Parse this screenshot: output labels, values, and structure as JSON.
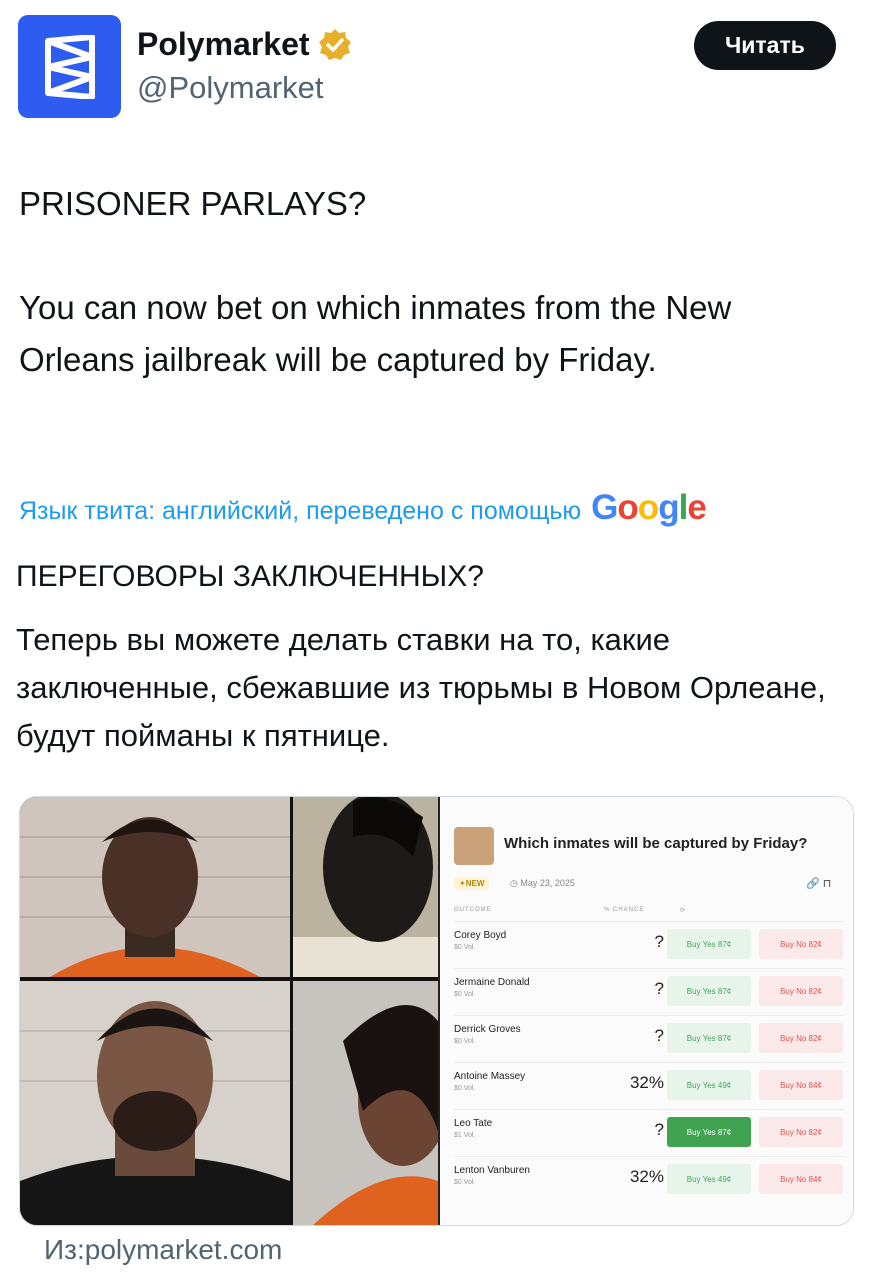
{
  "account": {
    "name": "Polymarket",
    "handle": "@Polymarket",
    "follow_label": "Читать",
    "avatar_color": "#2e5bf0",
    "verified": true
  },
  "tweet": {
    "title": "PRISONER PARLAYS?",
    "body": "You can now bet on which inmates from the New Orleans jailbreak will be captured by Friday."
  },
  "translation": {
    "notice": "Язык твита: английский, переведено с помощью",
    "provider": "Google",
    "title": "ПЕРЕГОВОРЫ ЗАКЛЮЧЕННЫХ?",
    "body": "Теперь вы можете делать ставки на то, какие заключенные, сбежавшие из тюрьмы в Новом Орлеане, будут пойманы к пятнице."
  },
  "market": {
    "title": "Which inmates will be captured by Friday?",
    "badge": "✦NEW",
    "date": "May 23, 2025",
    "col_outcome": "OUTCOME",
    "col_chance": "% CHANCE",
    "outcomes": [
      {
        "name": "Corey Boyd",
        "vol": "$0 Vol.",
        "chance": "?",
        "buy_yes": "Buy Yes 87¢",
        "buy_no": "Buy No 82¢"
      },
      {
        "name": "Jermaine Donald",
        "vol": "$0 Vol.",
        "chance": "?",
        "buy_yes": "Buy Yes 87¢",
        "buy_no": "Buy No 82¢"
      },
      {
        "name": "Derrick Groves",
        "vol": "$0 Vol.",
        "chance": "?",
        "buy_yes": "Buy Yes 87¢",
        "buy_no": "Buy No 82¢"
      },
      {
        "name": "Antoine Massey",
        "vol": "$0 Vol.",
        "chance": "32%",
        "buy_yes": "Buy Yes 49¢",
        "buy_no": "Buy No 84¢"
      },
      {
        "name": "Leo Tate",
        "vol": "$1 Vol.",
        "chance": "?",
        "buy_yes": "Buy Yes 87¢",
        "buy_no": "Buy No 82¢"
      },
      {
        "name": "Lenton Vanburen",
        "vol": "$0 Vol.",
        "chance": "32%",
        "buy_yes": "Buy Yes 49¢",
        "buy_no": "Buy No 84¢"
      }
    ]
  },
  "source": "Из:polymarket.com"
}
